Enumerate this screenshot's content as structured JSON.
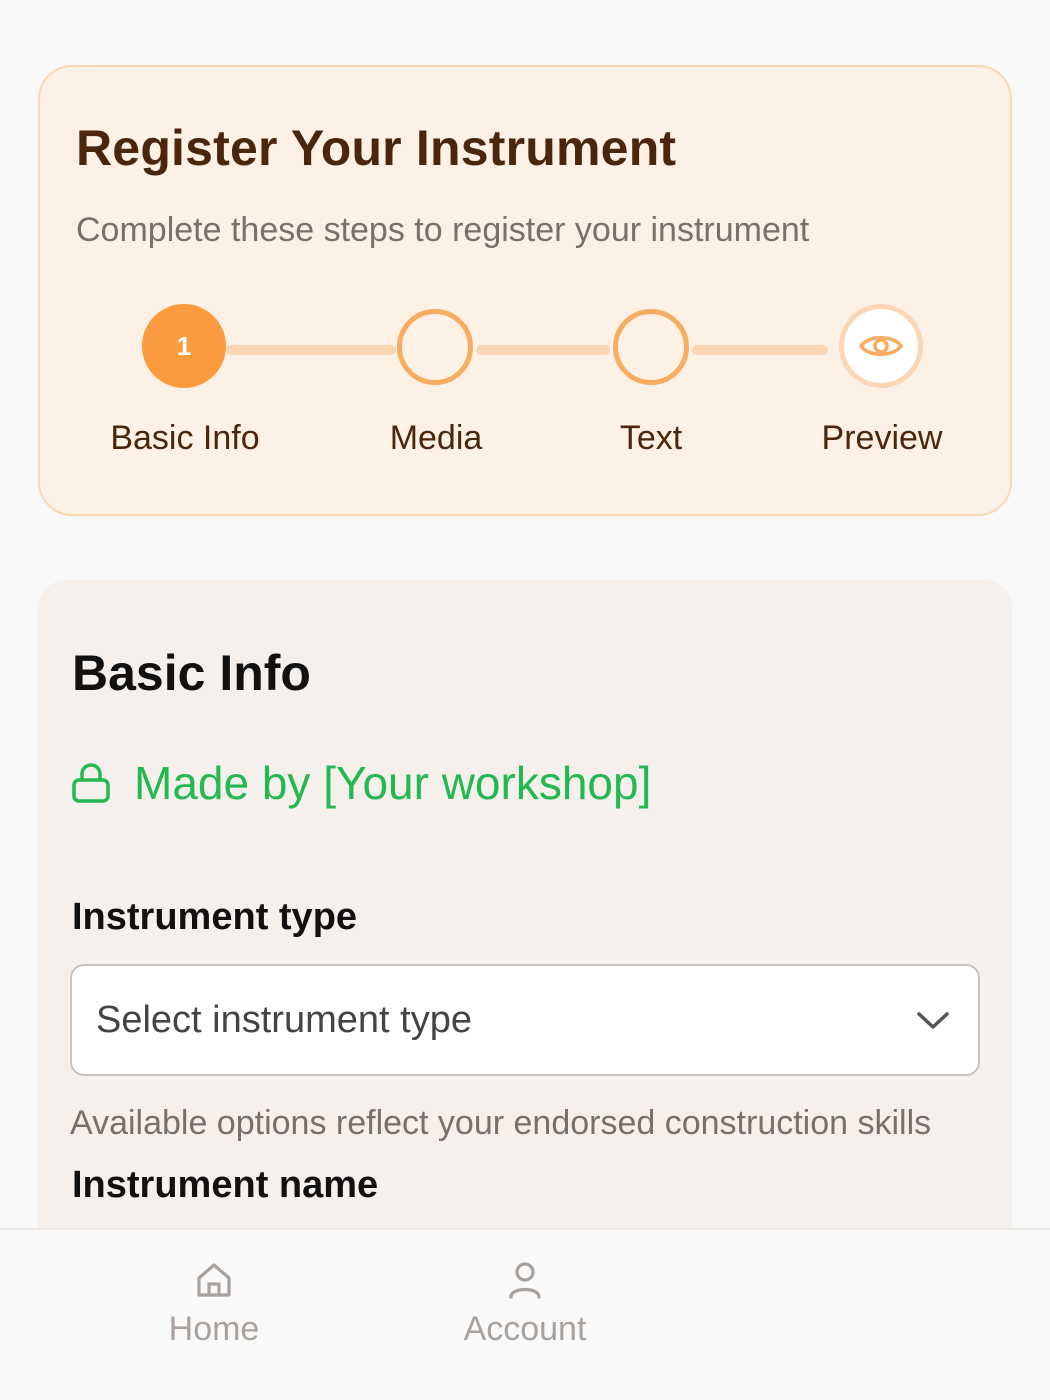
{
  "header": {
    "title": "Register Your Instrument",
    "subtitle": "Complete these steps to register your instrument"
  },
  "steps": [
    {
      "number": "1",
      "label": "Basic Info",
      "state": "active"
    },
    {
      "number": "",
      "label": "Media",
      "state": "pending"
    },
    {
      "number": "",
      "label": "Text",
      "state": "pending"
    },
    {
      "number": "",
      "label": "Preview",
      "state": "preview",
      "icon": "eye-icon"
    }
  ],
  "form": {
    "title": "Basic Info",
    "made_by": "Made by [Your workshop]",
    "made_by_icon": "lock-icon",
    "instrument_type": {
      "label": "Instrument type",
      "placeholder": "Select instrument type",
      "helper": "Available options reflect your endorsed construction skills"
    },
    "instrument_name": {
      "label": "Instrument name"
    }
  },
  "nav": {
    "items": [
      {
        "label": "Home",
        "icon": "home-icon"
      },
      {
        "label": "Account",
        "icon": "user-icon"
      }
    ]
  },
  "colors": {
    "accent": "#fa9b3f",
    "success": "#23b850",
    "title_brown": "#4a260d"
  }
}
